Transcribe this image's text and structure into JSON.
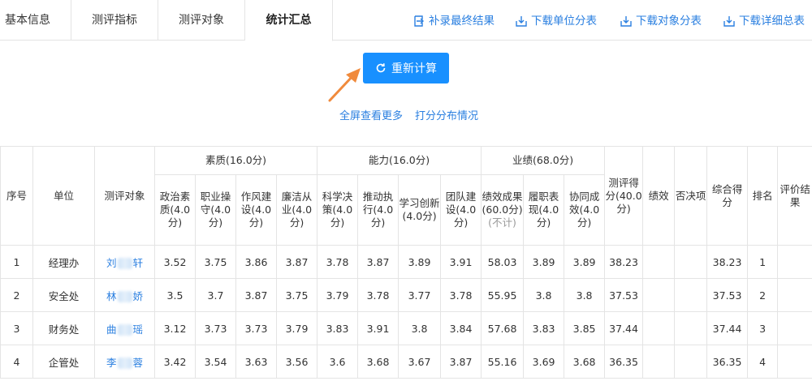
{
  "tabs": [
    {
      "label": "基本信息"
    },
    {
      "label": "测评指标"
    },
    {
      "label": "测评对象"
    },
    {
      "label": "统计汇总"
    }
  ],
  "actions": {
    "supplement": "补录最终结果",
    "download_unit": "下载单位分表",
    "download_object": "下载对象分表",
    "download_detail": "下载详细总表"
  },
  "recalc": {
    "label": "重新计算"
  },
  "links": {
    "fullscreen": "全屏查看更多",
    "distribution": "打分分布情况"
  },
  "table": {
    "headers": {
      "index": "序号",
      "unit": "单位",
      "object": "测评对象",
      "group_quality": "素质(16.0分)",
      "group_ability": "能力(16.0分)",
      "group_performance": "业绩(68.0分)",
      "political": "政治素质(4.0分)",
      "professional": "职业操守(4.0分)",
      "style": "作风建设(4.0分)",
      "integrity": "廉洁从业(4.0分)",
      "decision": "科学决策(4.0分)",
      "execution": "推动执行(4.0分)",
      "innovation": "学习创新(4.0分)",
      "team": "团队建设(4.0分)",
      "achievement": "绩效成果(60.0分)",
      "achievement_note": "(不计)",
      "duty": "履职表现(4.0分)",
      "coop": "协同成效(4.0分)",
      "eval_score": "测评得分(40.0分)",
      "perf": "绩效",
      "veto": "否决项",
      "total": "综合得分",
      "rank": "排名",
      "result": "评价结果"
    },
    "rows": [
      {
        "index": "1",
        "unit": "经理办",
        "name_a": "刘",
        "name_b": "轩",
        "political": "3.52",
        "professional": "3.75",
        "style": "3.86",
        "integrity": "3.87",
        "decision": "3.78",
        "execution": "3.87",
        "innovation": "3.89",
        "team": "3.91",
        "achievement": "58.03",
        "duty": "3.89",
        "coop": "3.89",
        "eval_score": "38.23",
        "perf": "",
        "veto": "",
        "total": "38.23",
        "rank": "1",
        "result": ""
      },
      {
        "index": "2",
        "unit": "安全处",
        "name_a": "林",
        "name_b": "娇",
        "political": "3.5",
        "professional": "3.7",
        "style": "3.87",
        "integrity": "3.75",
        "decision": "3.79",
        "execution": "3.78",
        "innovation": "3.77",
        "team": "3.78",
        "achievement": "55.95",
        "duty": "3.8",
        "coop": "3.8",
        "eval_score": "37.53",
        "perf": "",
        "veto": "",
        "total": "37.53",
        "rank": "2",
        "result": ""
      },
      {
        "index": "3",
        "unit": "财务处",
        "name_a": "曲",
        "name_b": "瑶",
        "political": "3.12",
        "professional": "3.73",
        "style": "3.73",
        "integrity": "3.79",
        "decision": "3.83",
        "execution": "3.91",
        "innovation": "3.8",
        "team": "3.84",
        "achievement": "57.68",
        "duty": "3.83",
        "coop": "3.85",
        "eval_score": "37.44",
        "perf": "",
        "veto": "",
        "total": "37.44",
        "rank": "3",
        "result": ""
      },
      {
        "index": "4",
        "unit": "企管处",
        "name_a": "李",
        "name_b": "蓉",
        "political": "3.42",
        "professional": "3.54",
        "style": "3.63",
        "integrity": "3.56",
        "decision": "3.6",
        "execution": "3.68",
        "innovation": "3.67",
        "team": "3.87",
        "achievement": "55.16",
        "duty": "3.69",
        "coop": "3.68",
        "eval_score": "36.35",
        "perf": "",
        "veto": "",
        "total": "36.35",
        "rank": "4",
        "result": ""
      }
    ]
  },
  "colors": {
    "accent": "#1890ff",
    "link": "#2a7fe0",
    "arrow": "#f08a3c",
    "border": "#e4e4e4"
  }
}
